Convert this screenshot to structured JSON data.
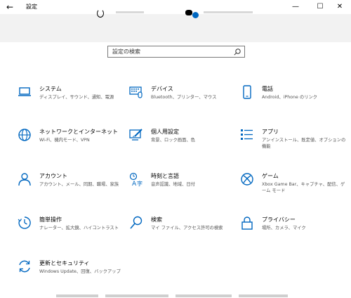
{
  "window": {
    "title": "設定",
    "back_icon": "back-arrow-icon",
    "controls": [
      "minimize-icon",
      "maximize-icon",
      "close-icon"
    ]
  },
  "search": {
    "placeholder": "設定の検索"
  },
  "tiles": [
    {
      "title": "システム",
      "desc": "ディスプレイ、サウンド、通知、電源",
      "icon": "laptop-icon"
    },
    {
      "title": "デバイス",
      "desc": "Bluetooth、プリンター、マウス",
      "icon": "keyboard-icon"
    },
    {
      "title": "電話",
      "desc": "Android、iPhone のリンク",
      "icon": "phone-icon"
    },
    {
      "title": "ネットワークとインターネット",
      "desc": "Wi-Fi、機内モード、VPN",
      "icon": "globe-icon"
    },
    {
      "title": "個人用設定",
      "desc": "背景、ロック画面、色",
      "icon": "personalization-icon"
    },
    {
      "title": "アプリ",
      "desc": "アンインストール、既定値、オプションの機能",
      "icon": "apps-icon"
    },
    {
      "title": "アカウント",
      "desc": "アカウント、メール、同期、職場、家族",
      "icon": "person-icon"
    },
    {
      "title": "時刻と言語",
      "desc": "音声認識、地域、日付",
      "icon": "time-language-icon"
    },
    {
      "title": "ゲーム",
      "desc": "Xbox Game Bar、キャプチャ、配信、ゲーム モード",
      "icon": "xbox-icon"
    },
    {
      "title": "簡単操作",
      "desc": "ナレーター、拡大鏡、ハイコントラスト",
      "icon": "ease-of-access-icon"
    },
    {
      "title": "検索",
      "desc": "マイ ファイル、アクセス許可の検索",
      "icon": "search-icon"
    },
    {
      "title": "プライバシー",
      "desc": "場所、カメラ、マイク",
      "icon": "lock-icon"
    },
    {
      "title": "更新とセキュリティ",
      "desc": "Windows Update、回復、バックアップ",
      "icon": "update-icon"
    }
  ],
  "colors": {
    "accent": "#0067c0",
    "header_band": "#f2f2f2"
  }
}
